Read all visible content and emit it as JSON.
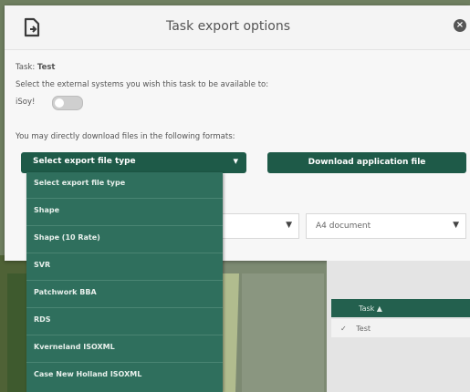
{
  "dialog": {
    "title": "Task export options",
    "task_label": "Task:",
    "task_name": "Test",
    "systems_text": "Select the external systems you wish this task to be available to:",
    "isoy_label": "iSoy!",
    "formats_text": "You may directly download files in the following formats:",
    "select_label": "Select export file type",
    "download_label": "Download application file",
    "field_right_value": "A4 document"
  },
  "dropdown": {
    "items": [
      "Select export file type",
      "Shape",
      "Shape (10 Rate)",
      "SVR",
      "Patchwork BBA",
      "RDS",
      "Kverneland ISOXML",
      "Case New Holland ISOXML"
    ]
  },
  "table": {
    "header": "Task ▲",
    "row_check": "✓",
    "row_value": "Test"
  },
  "colors": {
    "brand_green": "#1e5a48",
    "dropdown_green": "#2f6f5d",
    "map_background": "#7b8a69"
  },
  "icons": {
    "app": "export-document-icon",
    "close": "close-icon",
    "caret": "caret-down-icon"
  }
}
